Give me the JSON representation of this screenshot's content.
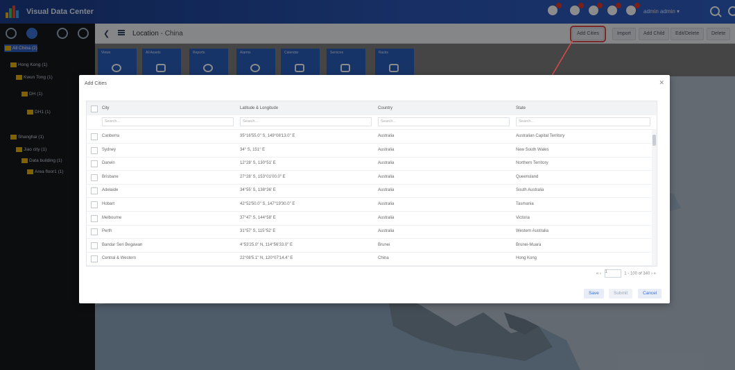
{
  "app": {
    "title": "Visual Data Center",
    "user": "admin admin ▾"
  },
  "colors": {
    "topbar": "#2a56b6",
    "sidebar": "#14181c",
    "tile": "#2a5fc0",
    "highlight": "#d94a4a",
    "folder": "#e9b400"
  },
  "sidebar": {
    "icons": [
      "monitor-icon",
      "globe-icon",
      "grid-icon",
      "target-icon"
    ],
    "tree": [
      {
        "label": "All China (2)",
        "level": 0,
        "selected": true
      },
      {
        "label": "Hong Kong (1)",
        "level": 1
      },
      {
        "label": "Kwun Tong (1)",
        "level": 2
      },
      {
        "label": "DH (1)",
        "level": 3
      },
      {
        "label": "DH1 (1)",
        "level": 4
      },
      {
        "label": "Shanghai (1)",
        "level": 1
      },
      {
        "label": "Jiao city (1)",
        "level": 2
      },
      {
        "label": "Data building (1)",
        "level": 3
      },
      {
        "label": "Area floor1 (1)",
        "level": 4
      }
    ]
  },
  "header": {
    "location_label": "Location",
    "location_value": "China",
    "buttons": [
      "Add Cities",
      "Import",
      "Add Child",
      "Edit/Delete",
      "Delete"
    ]
  },
  "tiles": [
    "Views",
    "All Assets",
    "Reports",
    "Alarms",
    "Calendar",
    "Services",
    "Racks"
  ],
  "modal": {
    "title": "Add Cities",
    "columns": [
      "City",
      "Latitude & Longitude",
      "Country",
      "State"
    ],
    "filter_placeholder": "Search...",
    "rows": [
      [
        "Canberra",
        "35°16'55.0\" S, 149°08'13.0\" E",
        "Australia",
        "Australian Capital Territory"
      ],
      [
        "Sydney",
        "34° S, 151° E",
        "Australia",
        "New South Wales"
      ],
      [
        "Darwin",
        "12°28' S, 130°51' E",
        "Australia",
        "Northern Territory"
      ],
      [
        "Brisbane",
        "27°28' S, 153°01'00.0\" E",
        "Australia",
        "Queensland"
      ],
      [
        "Adelaide",
        "34°55' S, 138°36' E",
        "Australia",
        "South Australia"
      ],
      [
        "Hobart",
        "42°52'50.0\" S, 147°19'30.0\" E",
        "Australia",
        "Tasmania"
      ],
      [
        "Melbourne",
        "37°47' S, 144°58' E",
        "Australia",
        "Victoria"
      ],
      [
        "Perth",
        "31°57' S, 115°52' E",
        "Australia",
        "Western Australia"
      ],
      [
        "Bandar Seri Begawan",
        "4°53'25.0\" N, 114°56'33.0\" E",
        "Brunei",
        "Brunei-Muara"
      ],
      [
        "Central & Western",
        "22°08'5.1\" N, 120°07'14.4\" E",
        "China",
        "Hong Kong"
      ]
    ],
    "pager": {
      "first": "«",
      "prev": "‹",
      "page": "1",
      "range": "1 - 100 of 340",
      "next": "›",
      "last": "»"
    },
    "buttons": {
      "save": "Save",
      "submit": "Submit",
      "cancel": "Cancel"
    }
  }
}
